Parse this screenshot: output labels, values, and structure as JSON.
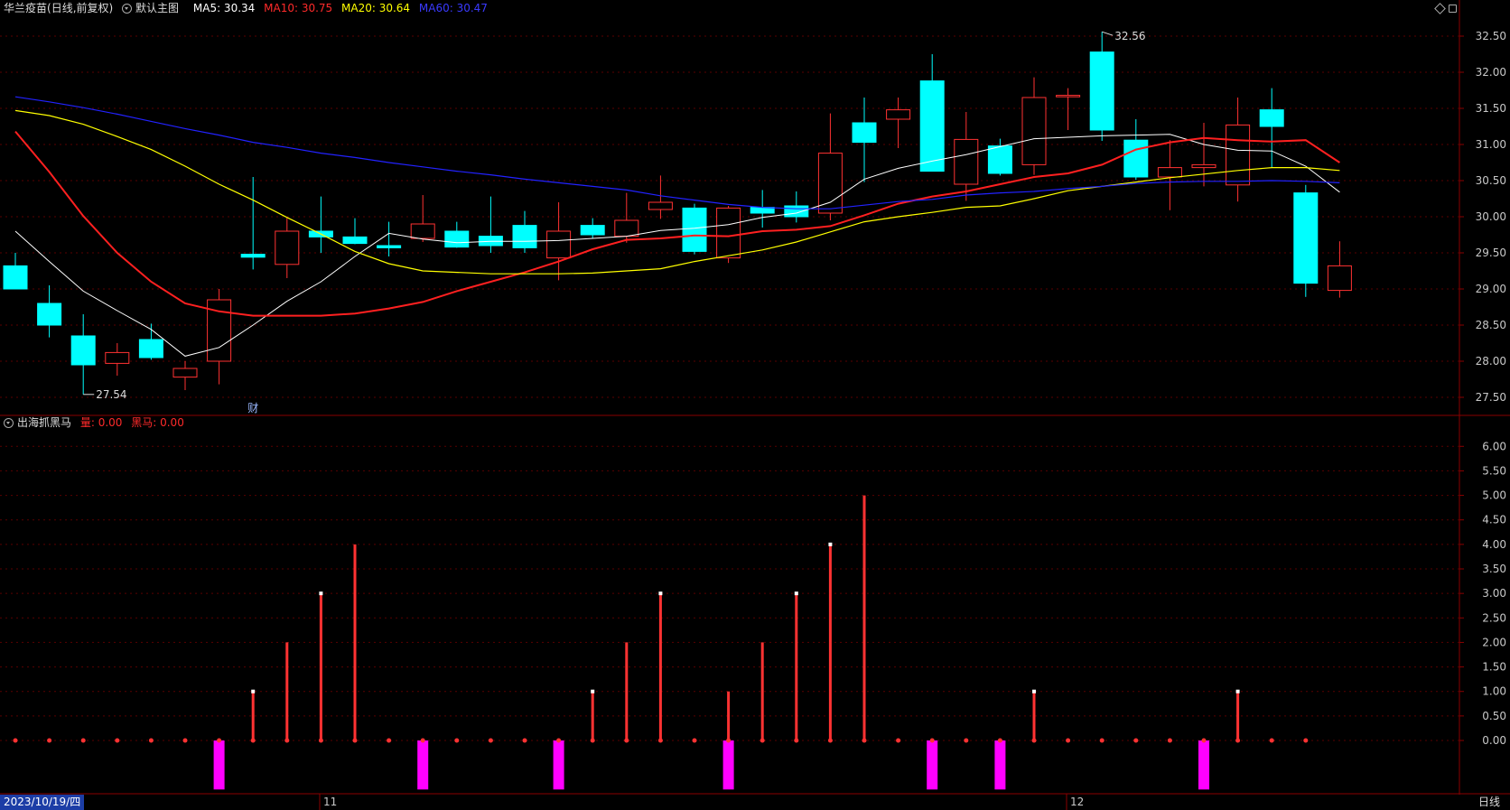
{
  "header": {
    "stock_name": "华兰疫苗",
    "period_label": "(日线,前复权)",
    "main_chart_label": "默认主图",
    "ma5_label": "MA5: 30.34",
    "ma10_label": "MA10: 30.75",
    "ma20_label": "MA20: 30.64",
    "ma60_label": "MA60: 30.47"
  },
  "indicator_header": {
    "name": "出海抓黑马",
    "liang_label": "量: 0.00",
    "heima_label": "黑马: 0.00"
  },
  "footer": {
    "date": "2023/10/19/四",
    "month_nov": "11",
    "month_dec": "12",
    "cycle": "日线"
  },
  "colors": {
    "up": "#ff3232",
    "down": "#00ffff",
    "ma5": "#ffffff",
    "ma10": "#ff2020",
    "ma20": "#ffff00",
    "ma60": "#2222ff",
    "magenta": "#ff00ff",
    "grid": "#5a0000",
    "axis_text": "#c8c8c8"
  },
  "chart_data": [
    {
      "type": "candlestick",
      "title": "华兰疫苗 (日线,前复权)",
      "ylim": [
        27.25,
        32.75
      ],
      "yticks": [
        "27.50",
        "28.00",
        "28.50",
        "29.00",
        "29.50",
        "30.00",
        "30.50",
        "31.00",
        "31.50",
        "32.00",
        "32.50"
      ],
      "high_marker": "32.56",
      "low_marker": "27.54",
      "event_marker": "财",
      "candles": [
        {
          "o": 29.32,
          "h": 29.5,
          "l": 29.0,
          "c": 29.0
        },
        {
          "o": 28.8,
          "h": 29.05,
          "l": 28.33,
          "c": 28.5
        },
        {
          "o": 28.35,
          "h": 28.65,
          "l": 27.54,
          "c": 27.95
        },
        {
          "o": 27.97,
          "h": 28.25,
          "l": 27.8,
          "c": 28.12
        },
        {
          "o": 28.3,
          "h": 28.52,
          "l": 28.02,
          "c": 28.05
        },
        {
          "o": 27.78,
          "h": 28.0,
          "l": 27.6,
          "c": 27.9
        },
        {
          "o": 28.0,
          "h": 29.0,
          "l": 27.68,
          "c": 28.85
        },
        {
          "o": 29.48,
          "h": 30.55,
          "l": 29.27,
          "c": 29.44
        },
        {
          "o": 29.34,
          "h": 29.98,
          "l": 29.15,
          "c": 29.8
        },
        {
          "o": 29.8,
          "h": 30.28,
          "l": 29.5,
          "c": 29.72
        },
        {
          "o": 29.72,
          "h": 29.98,
          "l": 29.62,
          "c": 29.63
        },
        {
          "o": 29.6,
          "h": 29.93,
          "l": 29.45,
          "c": 29.57
        },
        {
          "o": 29.7,
          "h": 30.3,
          "l": 29.65,
          "c": 29.9
        },
        {
          "o": 29.8,
          "h": 29.93,
          "l": 29.57,
          "c": 29.58
        },
        {
          "o": 29.73,
          "h": 30.28,
          "l": 29.5,
          "c": 29.6
        },
        {
          "o": 29.88,
          "h": 30.08,
          "l": 29.5,
          "c": 29.57
        },
        {
          "o": 29.43,
          "h": 30.2,
          "l": 29.12,
          "c": 29.8
        },
        {
          "o": 29.88,
          "h": 29.98,
          "l": 29.7,
          "c": 29.75
        },
        {
          "o": 29.73,
          "h": 30.33,
          "l": 29.64,
          "c": 29.95
        },
        {
          "o": 30.1,
          "h": 30.57,
          "l": 29.97,
          "c": 30.2
        },
        {
          "o": 30.12,
          "h": 30.18,
          "l": 29.48,
          "c": 29.52
        },
        {
          "o": 29.43,
          "h": 30.15,
          "l": 29.36,
          "c": 30.12
        },
        {
          "o": 30.13,
          "h": 30.37,
          "l": 29.85,
          "c": 30.05
        },
        {
          "o": 30.15,
          "h": 30.35,
          "l": 29.92,
          "c": 30.0
        },
        {
          "o": 30.05,
          "h": 31.43,
          "l": 29.95,
          "c": 30.88
        },
        {
          "o": 31.3,
          "h": 31.65,
          "l": 30.48,
          "c": 31.03
        },
        {
          "o": 31.35,
          "h": 31.65,
          "l": 30.95,
          "c": 31.48
        },
        {
          "o": 31.88,
          "h": 32.25,
          "l": 30.63,
          "c": 30.63
        },
        {
          "o": 30.45,
          "h": 31.45,
          "l": 30.22,
          "c": 31.07
        },
        {
          "o": 30.98,
          "h": 31.08,
          "l": 30.57,
          "c": 30.6
        },
        {
          "o": 30.72,
          "h": 31.93,
          "l": 30.58,
          "c": 31.65
        },
        {
          "o": 31.66,
          "h": 31.78,
          "l": 31.2,
          "c": 31.68
        },
        {
          "o": 32.28,
          "h": 32.56,
          "l": 31.05,
          "c": 31.2
        },
        {
          "o": 31.06,
          "h": 31.35,
          "l": 30.51,
          "c": 30.55
        },
        {
          "o": 30.55,
          "h": 31.06,
          "l": 30.09,
          "c": 30.68
        },
        {
          "o": 30.68,
          "h": 31.3,
          "l": 30.42,
          "c": 30.72
        },
        {
          "o": 30.44,
          "h": 31.65,
          "l": 30.21,
          "c": 31.27
        },
        {
          "o": 31.48,
          "h": 31.78,
          "l": 30.68,
          "c": 31.25
        },
        {
          "o": 30.33,
          "h": 30.44,
          "l": 28.89,
          "c": 29.08
        },
        {
          "o": 28.98,
          "h": 29.66,
          "l": 28.88,
          "c": 29.32
        }
      ],
      "series": [
        {
          "name": "MA5",
          "values": [
            29.8,
            29.38,
            28.97,
            28.7,
            28.44,
            28.07,
            28.19,
            28.5,
            28.83,
            29.1,
            29.45,
            29.77,
            29.69,
            29.64,
            29.66,
            29.66,
            29.67,
            29.7,
            29.73,
            29.81,
            29.84,
            29.89,
            29.99,
            30.05,
            30.2,
            30.52,
            30.67,
            30.77,
            30.86,
            30.97,
            31.08,
            31.1,
            31.12,
            31.13,
            31.14,
            31.0,
            30.92,
            30.91,
            30.7,
            30.34
          ]
        },
        {
          "name": "MA10",
          "values": [
            31.18,
            30.62,
            30.01,
            29.5,
            29.1,
            28.8,
            28.69,
            28.63,
            28.63,
            28.63,
            28.66,
            28.73,
            28.82,
            28.97,
            29.1,
            29.23,
            29.38,
            29.55,
            29.68,
            29.7,
            29.74,
            29.73,
            29.8,
            29.82,
            29.87,
            30.02,
            30.18,
            30.28,
            30.35,
            30.45,
            30.55,
            30.6,
            30.72,
            30.93,
            31.03,
            31.09,
            31.06,
            31.04,
            31.06,
            30.75
          ]
        },
        {
          "name": "MA20",
          "values": [
            31.47,
            31.4,
            31.28,
            31.11,
            30.93,
            30.7,
            30.45,
            30.23,
            29.99,
            29.76,
            29.52,
            29.35,
            29.25,
            29.23,
            29.21,
            29.21,
            29.21,
            29.22,
            29.25,
            29.28,
            29.38,
            29.46,
            29.54,
            29.65,
            29.79,
            29.93,
            30.0,
            30.06,
            30.13,
            30.15,
            30.25,
            30.36,
            30.42,
            30.48,
            30.54,
            30.59,
            30.64,
            30.68,
            30.68,
            30.64
          ]
        },
        {
          "name": "MA60",
          "values": [
            31.66,
            31.59,
            31.51,
            31.42,
            31.32,
            31.22,
            31.13,
            31.03,
            30.96,
            30.88,
            30.82,
            30.75,
            30.69,
            30.63,
            30.58,
            30.52,
            30.47,
            30.42,
            30.37,
            30.29,
            30.23,
            30.17,
            30.13,
            30.11,
            30.11,
            30.16,
            30.21,
            30.24,
            30.3,
            30.33,
            30.35,
            30.39,
            30.42,
            30.46,
            30.48,
            30.49,
            30.49,
            30.5,
            30.49,
            30.47
          ]
        }
      ]
    },
    {
      "type": "bar",
      "title": "出海抓黑马",
      "ylim": [
        -1.05,
        6.3
      ],
      "yticks": [
        "0.00",
        "0.50",
        "1.00",
        "1.50",
        "2.00",
        "2.50",
        "3.00",
        "3.50",
        "4.00",
        "4.50",
        "5.00",
        "5.50",
        "6.00"
      ],
      "series": [
        {
          "name": "量",
          "values": [
            0,
            0,
            0,
            0,
            0,
            0,
            0,
            1,
            2,
            3,
            4,
            0,
            0,
            0,
            0,
            0,
            0,
            1,
            2,
            3,
            0,
            1,
            2,
            3,
            4,
            5,
            0,
            0,
            0,
            0,
            1,
            0,
            0,
            0,
            0,
            0,
            1,
            0,
            0
          ]
        },
        {
          "name": "黑马",
          "values": [
            0,
            0,
            0,
            0,
            0,
            0,
            1,
            0,
            0,
            0,
            0,
            0,
            1,
            0,
            0,
            0,
            1,
            0,
            0,
            0,
            0,
            1,
            0,
            0,
            0,
            0,
            0,
            1,
            0,
            1,
            0,
            0,
            0,
            0,
            0,
            1,
            0,
            0,
            0
          ]
        }
      ],
      "white_caps": [
        7,
        9,
        17,
        19,
        23,
        24,
        30,
        36
      ]
    }
  ]
}
